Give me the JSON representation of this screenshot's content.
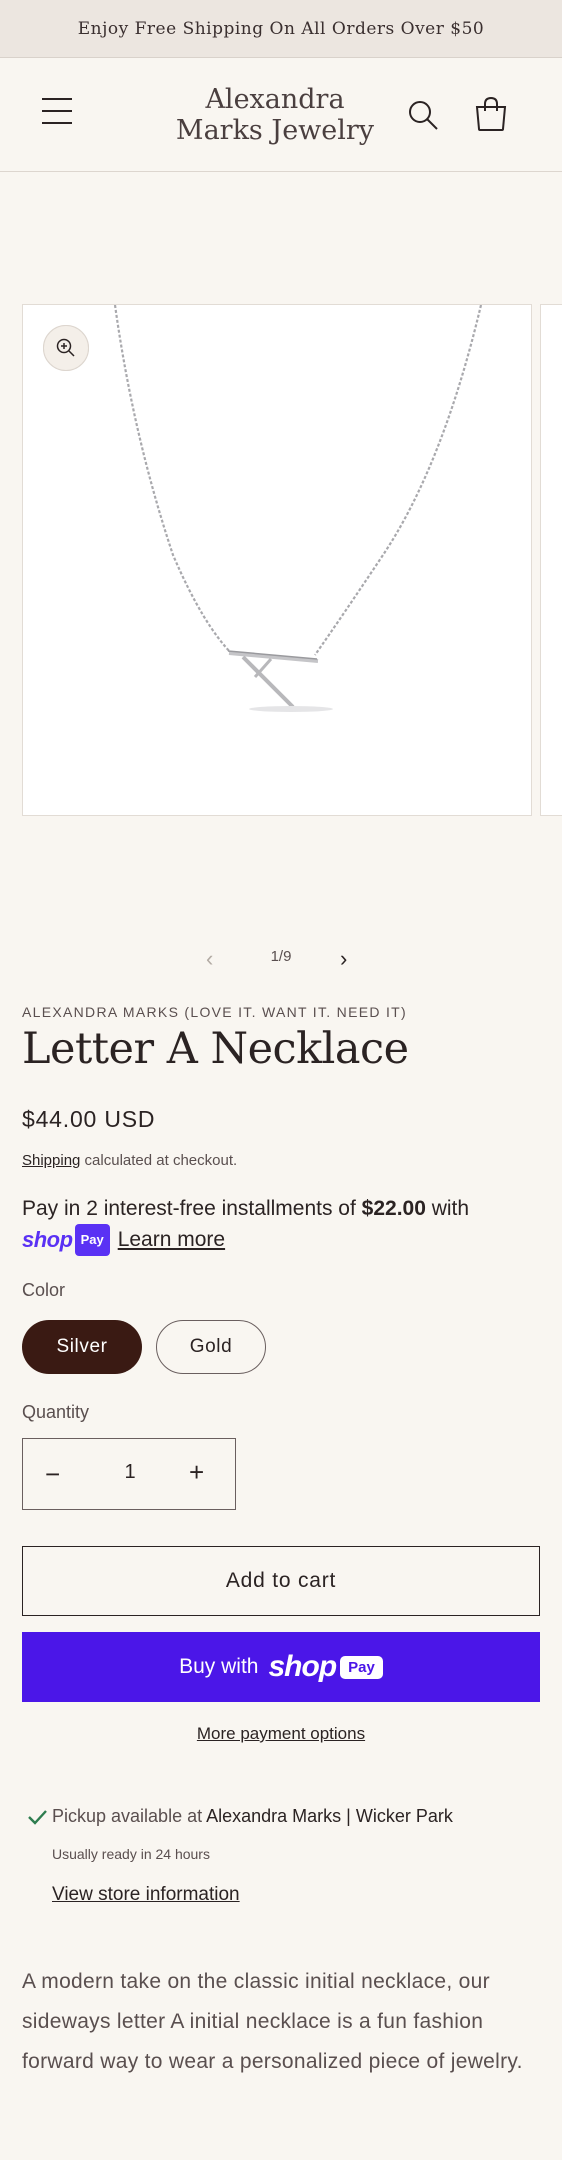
{
  "announcement": {
    "text": "Enjoy Free Shipping On All Orders Over $50"
  },
  "header": {
    "logo_line1": "Alexandra",
    "logo_line2": "Marks Jewelry",
    "icons": {
      "menu": "hamburger-icon",
      "search": "search-icon",
      "cart": "bag-icon"
    }
  },
  "gallery": {
    "current": "1/9",
    "zoom_icon": "zoom-in-icon",
    "prev_icon": "chevron-left-icon",
    "next_icon": "chevron-right-icon"
  },
  "product": {
    "vendor": "ALEXANDRA MARKS (LOVE IT. WANT IT. NEED IT)",
    "title": "Letter A Necklace",
    "price": "$44.00 USD",
    "shipping_link": "Shipping",
    "shipping_suffix": " calculated at checkout.",
    "installments_prefix": "Pay in 2 interest-free installments of ",
    "installments_amount": "$22.00",
    "installments_suffix": " with",
    "shop_pay_word": "shop",
    "shop_pay_box": "Pay",
    "learn_more": "Learn more"
  },
  "options": {
    "color_label": "Color",
    "colors": [
      "Silver",
      "Gold"
    ],
    "selected_color": "Silver",
    "quantity_label": "Quantity",
    "quantity_value": "1",
    "minus_icon": "minus-icon",
    "plus_icon": "plus-icon"
  },
  "actions": {
    "add_to_cart": "Add to cart",
    "buy_with": "Buy with",
    "buy_shop_word": "shop",
    "buy_pay_box": "Pay",
    "more_payment": "More payment options"
  },
  "pickup": {
    "prefix": "Pickup available at ",
    "store": "Alexandra Marks | Wicker Park",
    "ready": "Usually ready in 24 hours",
    "store_info": "View store information",
    "check_icon": "check-icon"
  },
  "description": "A modern take on the classic initial necklace, our sideways letter A initial necklace is a fun fashion forward way to wear a personalized piece of jewelry.",
  "colors": {
    "background": "#f9f6f1",
    "announcement_bg": "#ece6e0",
    "text": "#2b2323",
    "selected_swatch": "#3a1a13",
    "shop_pay": "#4b16e8",
    "check": "#2e7d4f"
  }
}
